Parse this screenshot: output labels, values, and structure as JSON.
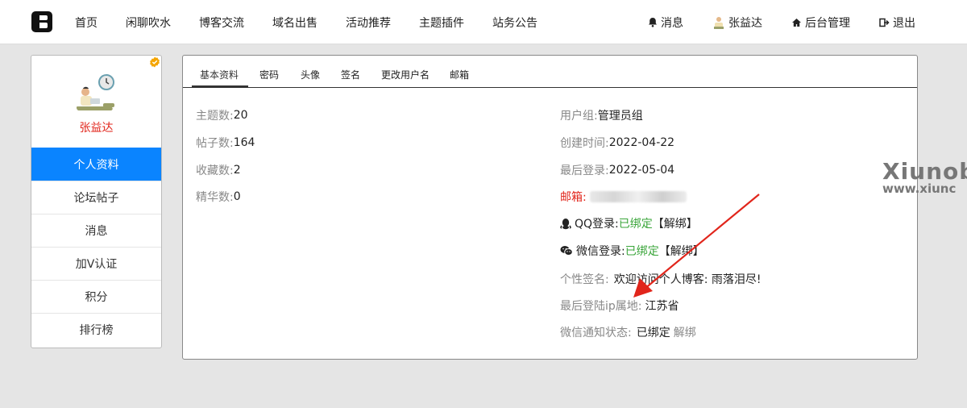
{
  "nav": {
    "items": [
      "首页",
      "闲聊吹水",
      "博客交流",
      "域名出售",
      "活动推荐",
      "主题插件",
      "站务公告"
    ]
  },
  "right_nav": {
    "messages": "消息",
    "user": "张益达",
    "admin": "后台管理",
    "logout": "退出"
  },
  "sidebar": {
    "username": "张益达",
    "menu": [
      "个人资料",
      "论坛帖子",
      "消息",
      "加V认证",
      "积分",
      "排行榜"
    ]
  },
  "tabs": [
    "基本资料",
    "密码",
    "头像",
    "签名",
    "更改用户名",
    "邮箱"
  ],
  "stats": {
    "threads_label": "主题数:",
    "threads": "20",
    "posts_label": "帖子数:",
    "posts": "164",
    "favorites_label": "收藏数:",
    "favorites": "2",
    "essence_label": "精华数:",
    "essence": "0"
  },
  "info": {
    "group_label": "用户组:",
    "group": "管理员组",
    "created_label": "创建时间:",
    "created": "2022-04-22",
    "last_login_label": "最后登录:",
    "last_login": "2022-05-04",
    "email_label": "邮箱:",
    "qq_label": "QQ登录:",
    "qq_status": "已绑定",
    "qq_action": "【解绑】",
    "wechat_label": "微信登录:",
    "wechat_status": "已绑定",
    "wechat_action": "【解绑】",
    "signature_label": "个性签名:",
    "signature": "欢迎访问个人博客: 雨落泪尽!",
    "ip_label": "最后登陆ip属地:",
    "ip_location": "江苏省",
    "notify_label": "微信通知状态:",
    "notify_status": "已绑定",
    "notify_action": "解绑"
  },
  "watermark": {
    "line1": "Xiunob",
    "line2": "www.xiunc"
  },
  "colors": {
    "accent": "#0a84ff",
    "username": "#e1251b",
    "bound": "#3aa53a",
    "arrow": "#e1251b"
  }
}
